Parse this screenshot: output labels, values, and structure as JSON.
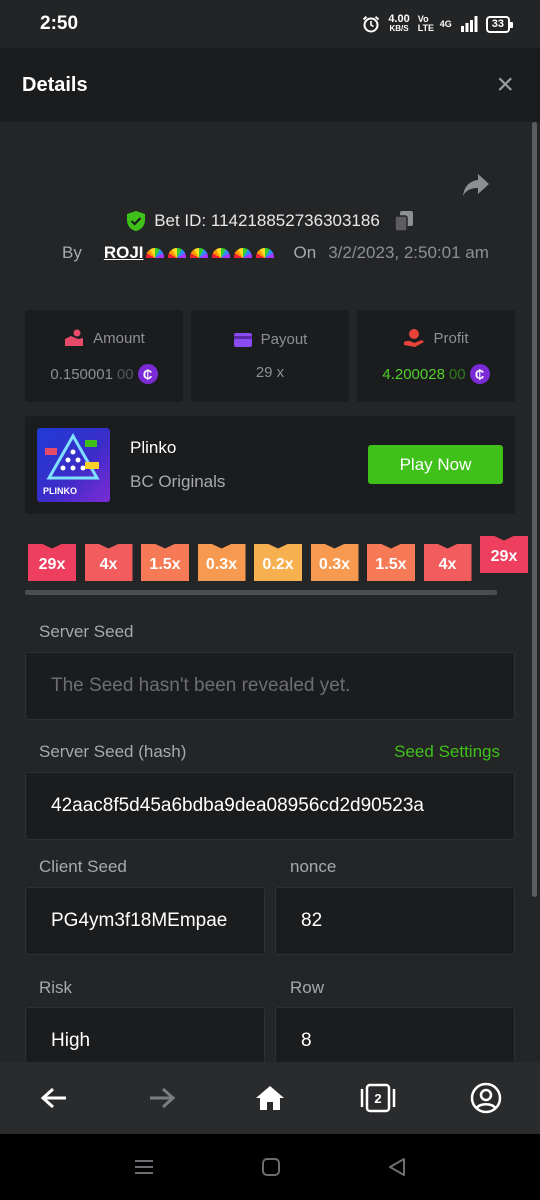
{
  "status": {
    "time": "2:50",
    "speed_value": "4.00",
    "speed_unit": "KB/S",
    "volte": "Vo LTE",
    "network": "4G",
    "battery": "33"
  },
  "header": {
    "title": "Details",
    "close_label": "×"
  },
  "bet": {
    "id_label": "Bet ID: 114218852736303186",
    "by_label": "By",
    "user": "ROJI",
    "on_label": "On",
    "date": "3/2/2023, 2:50:01 am"
  },
  "stats": {
    "amount": {
      "label": "Amount",
      "value_main": "0.150001",
      "value_faded": "00"
    },
    "payout": {
      "label": "Payout",
      "value": "29 x"
    },
    "profit": {
      "label": "Profit",
      "value_main": "4.200028",
      "value_faded": "00"
    }
  },
  "game": {
    "name": "Plinko",
    "provider": "BC Originals",
    "play_label": "Play Now",
    "thumb_label": "PLINKO"
  },
  "multipliers": [
    {
      "label": "29x",
      "color": "#ef3f5e"
    },
    {
      "label": "4x",
      "color": "#f25c5c"
    },
    {
      "label": "1.5x",
      "color": "#f57a55"
    },
    {
      "label": "0.3x",
      "color": "#f79a50"
    },
    {
      "label": "0.2x",
      "color": "#f7b04f"
    },
    {
      "label": "0.3x",
      "color": "#f79a50"
    },
    {
      "label": "1.5x",
      "color": "#f57a55"
    },
    {
      "label": "4x",
      "color": "#f25c5c"
    },
    {
      "label": "29x",
      "color": "#ef3f5e"
    }
  ],
  "fields": {
    "server_seed_label": "Server Seed",
    "server_seed_placeholder": "The Seed hasn't been revealed yet.",
    "server_hash_label": "Server Seed (hash)",
    "seed_settings": "Seed Settings",
    "server_hash": "42aac8f5d45a6bdba9dea08956cd2d90523a",
    "client_seed_label": "Client Seed",
    "client_seed": "PG4ym3f18MEmpae",
    "nonce_label": "nonce",
    "nonce": "82",
    "risk_label": "Risk",
    "risk": "High",
    "row_label": "Row",
    "row": "8"
  },
  "nav": {
    "tabs_count": "2"
  }
}
